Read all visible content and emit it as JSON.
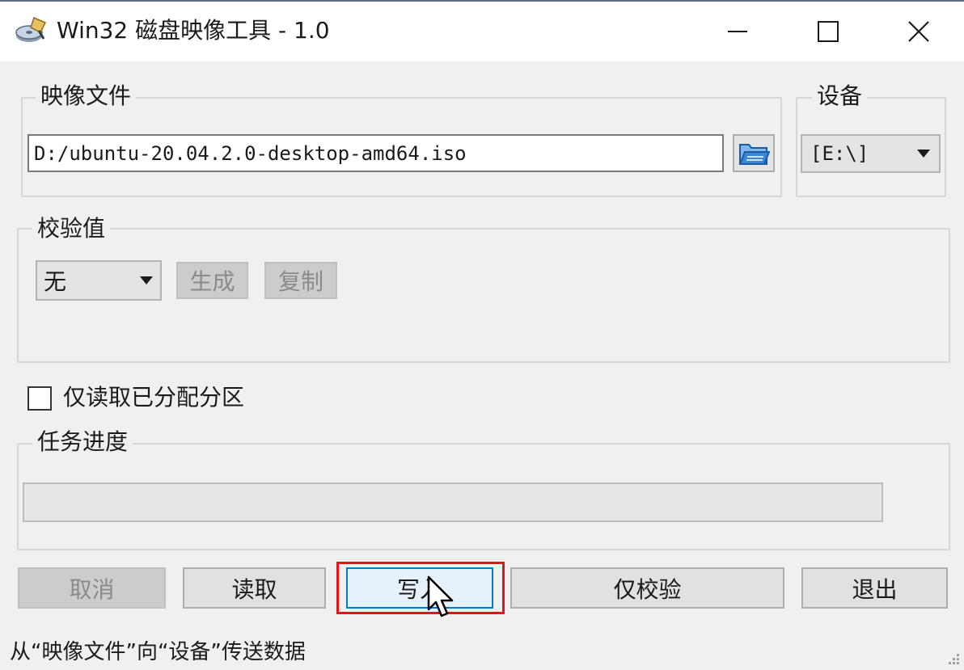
{
  "window": {
    "title": "Win32 磁盘映像工具 - 1.0",
    "icons": {
      "app": "disk-imager-icon",
      "minimize": "minimize-icon",
      "maximize": "maximize-icon",
      "close": "close-icon"
    }
  },
  "image_file": {
    "label": "映像文件",
    "path": "D:/ubuntu-20.04.2.0-desktop-amd64.iso",
    "browse_icon": "folder-open-icon"
  },
  "device": {
    "label": "设备",
    "selected": "[E:\\]"
  },
  "hash": {
    "label": "校验值",
    "selected": "无",
    "generate_label": "生成",
    "copy_label": "复制"
  },
  "options": {
    "readonly_label": "仅读取已分配分区",
    "readonly_checked": false
  },
  "progress": {
    "label": "任务进度",
    "value_percent": 0
  },
  "buttons": {
    "cancel": "取消",
    "read": "读取",
    "write": "写入",
    "verify": "仅校验",
    "exit": "退出"
  },
  "status": {
    "text": "从“映像文件”向“设备”传送数据"
  },
  "colors": {
    "highlight_border": "#e0141b",
    "focus_border": "#0078d7",
    "folder_icon": "#3a86d8"
  }
}
